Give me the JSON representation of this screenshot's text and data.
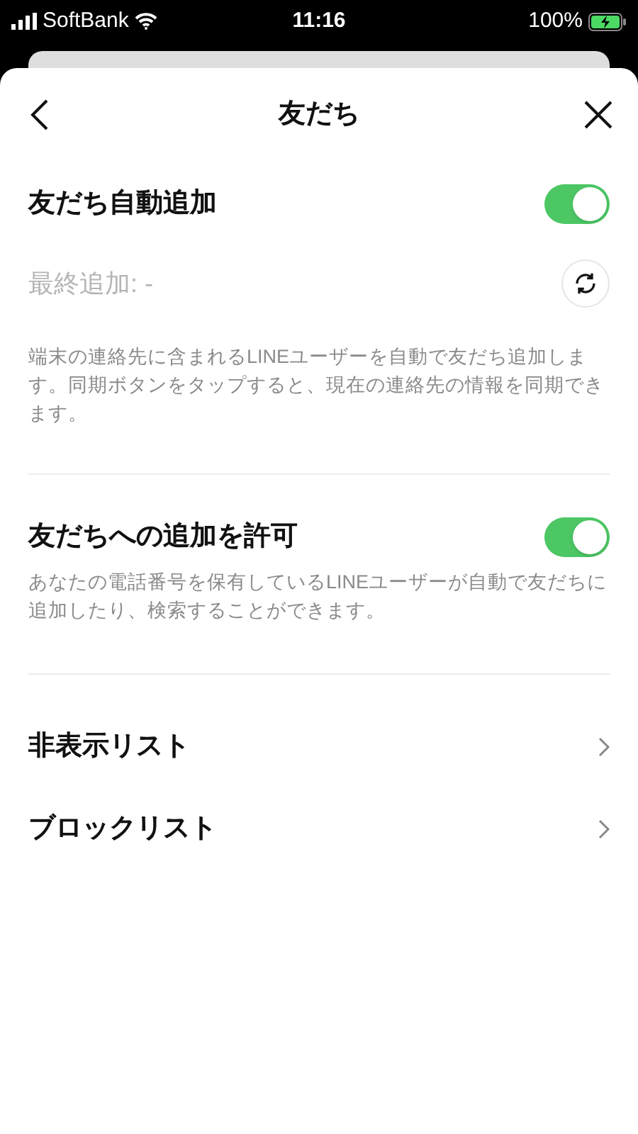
{
  "status_bar": {
    "carrier": "SoftBank",
    "time": "11:16",
    "battery": "100%",
    "charging": true
  },
  "header": {
    "title": "友だち"
  },
  "auto_add": {
    "label": "友だち自動追加",
    "on": true,
    "last_added": "最終追加: -",
    "description": "端末の連絡先に含まれるLINEユーザーを自動で友だち追加します。同期ボタンをタップすると、現在の連絡先の情報を同期できます。"
  },
  "allow_add": {
    "label": "友だちへの追加を許可",
    "on": true,
    "description": "あなたの電話番号を保有しているLINEユーザーが自動で友だちに追加したり、検索することができます。"
  },
  "list_items": [
    {
      "label": "非表示リスト"
    },
    {
      "label": "ブロックリスト"
    }
  ]
}
